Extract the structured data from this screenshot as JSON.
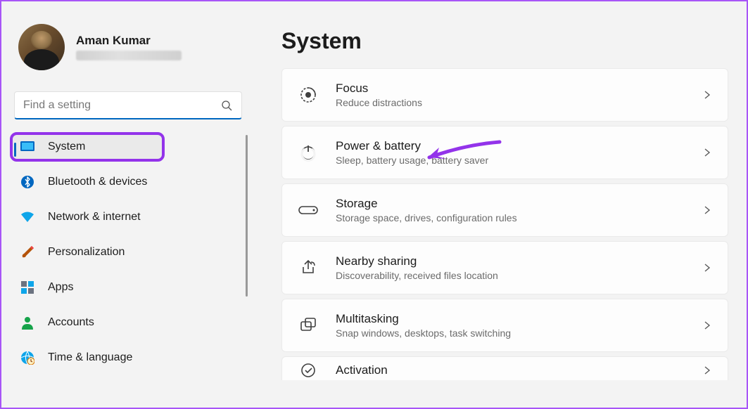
{
  "user": {
    "name": "Aman Kumar"
  },
  "search": {
    "placeholder": "Find a setting"
  },
  "sidebar": {
    "items": [
      {
        "label": "System",
        "icon": "display",
        "active": true
      },
      {
        "label": "Bluetooth & devices",
        "icon": "bluetooth"
      },
      {
        "label": "Network & internet",
        "icon": "wifi"
      },
      {
        "label": "Personalization",
        "icon": "brush"
      },
      {
        "label": "Apps",
        "icon": "apps"
      },
      {
        "label": "Accounts",
        "icon": "person"
      },
      {
        "label": "Time & language",
        "icon": "globe"
      }
    ]
  },
  "main": {
    "title": "System",
    "cards": [
      {
        "title": "Focus",
        "sub": "Reduce distractions",
        "icon": "focus"
      },
      {
        "title": "Power & battery",
        "sub": "Sleep, battery usage, battery saver",
        "icon": "power"
      },
      {
        "title": "Storage",
        "sub": "Storage space, drives, configuration rules",
        "icon": "storage"
      },
      {
        "title": "Nearby sharing",
        "sub": "Discoverability, received files location",
        "icon": "share"
      },
      {
        "title": "Multitasking",
        "sub": "Snap windows, desktops, task switching",
        "icon": "multitask"
      },
      {
        "title": "Activation",
        "sub": "",
        "icon": "activation"
      }
    ]
  },
  "annotation": {
    "highlight_item": "System",
    "arrow_target": "Power & battery",
    "color": "#9333ea"
  }
}
